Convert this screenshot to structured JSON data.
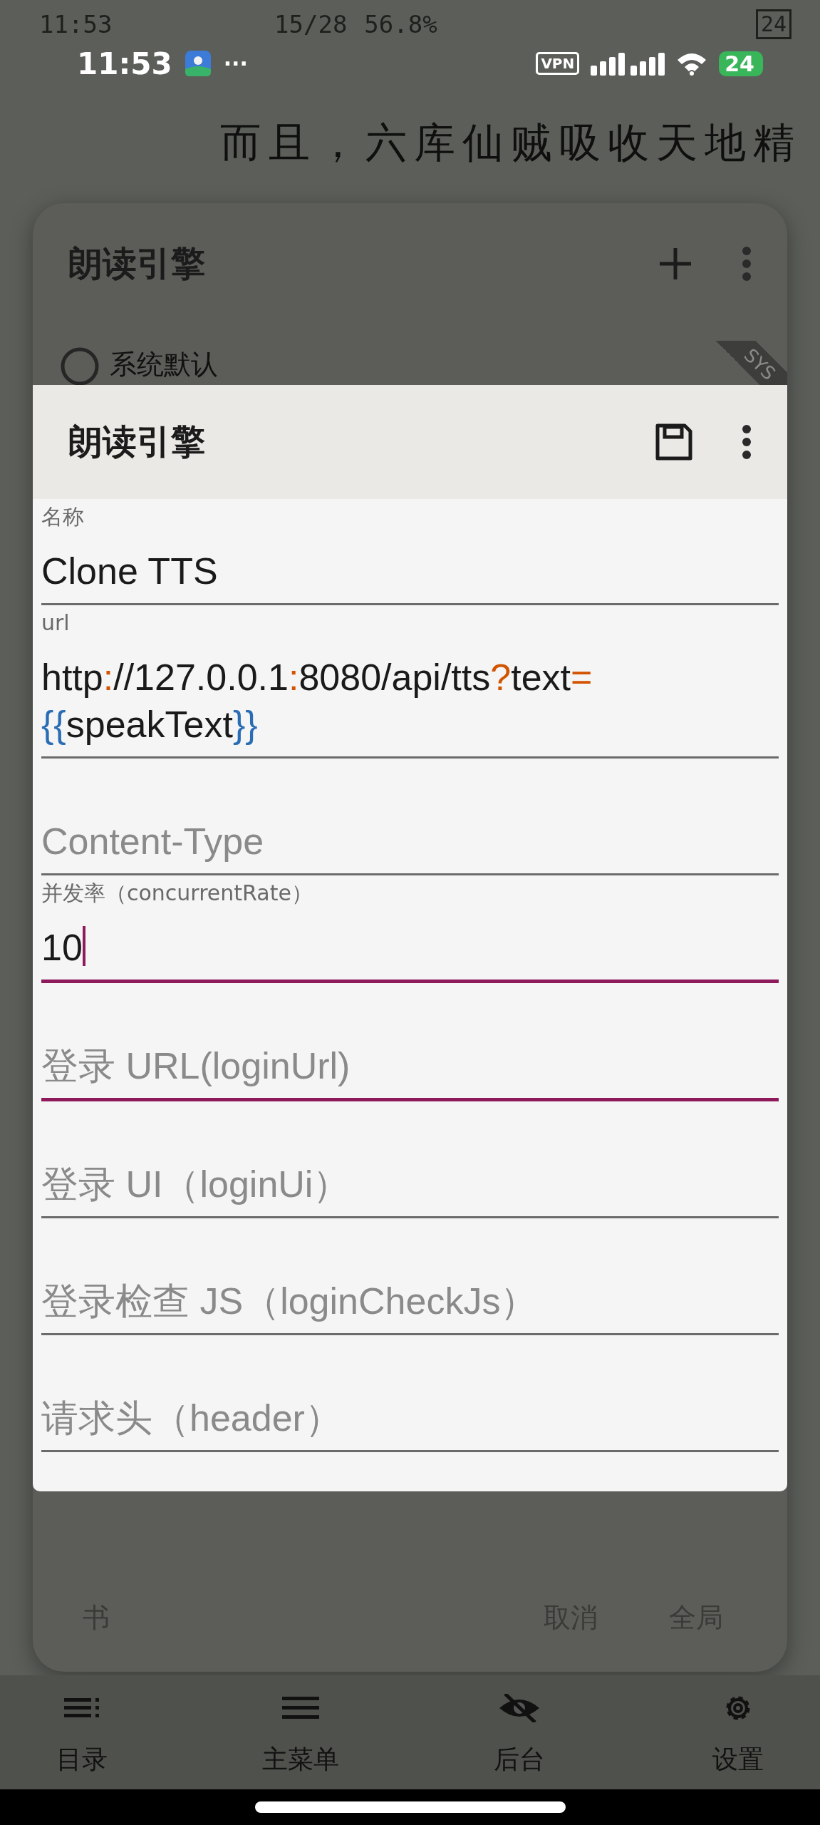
{
  "reader_status": {
    "time": "11:53",
    "progress": "15/28",
    "percent": "56.8%",
    "battery": "24"
  },
  "status_bar": {
    "time": "11:53",
    "more": "···",
    "vpn": "VPN",
    "battery": "24"
  },
  "reader_text": "而且，六库仙贼吸收天地精",
  "engine_list": {
    "title": "朗读引擎",
    "items": [
      {
        "label": "系统默认",
        "selected": false,
        "badge": "SYS"
      }
    ],
    "buttons": [
      "书",
      "取消",
      "全局"
    ]
  },
  "editor": {
    "title": "朗读引擎",
    "fields": [
      {
        "label": "名称",
        "value": "Clone TTS",
        "focused": false,
        "caret": false
      },
      {
        "label": "url",
        "segments": [
          {
            "text": "http",
            "kind": "text"
          },
          {
            "text": ":",
            "kind": "symbol"
          },
          {
            "text": "//127.0.0.1",
            "kind": "text"
          },
          {
            "text": ":",
            "kind": "symbol"
          },
          {
            "text": "8080/api/tts",
            "kind": "text"
          },
          {
            "text": "?",
            "kind": "symbol"
          },
          {
            "text": "text",
            "kind": "text"
          },
          {
            "text": "=",
            "kind": "symbol"
          },
          {
            "text": "{{",
            "kind": "brace"
          },
          {
            "text": "speakText",
            "kind": "text"
          },
          {
            "text": "}}",
            "kind": "brace"
          }
        ],
        "focused": false,
        "caret": false
      },
      {
        "placeholder": "Content-Type",
        "focused": false,
        "caret": false
      },
      {
        "label": "并发率（concurrentRate）",
        "value": "10",
        "focused": true,
        "caret": true
      },
      {
        "placeholder": "登录 URL(loginUrl)",
        "focused": true,
        "caret": false
      },
      {
        "placeholder": "登录 UI（loginUi）",
        "focused": false,
        "caret": false
      },
      {
        "placeholder": "登录检查 JS（loginCheckJs）",
        "focused": false,
        "caret": false
      },
      {
        "placeholder": "请求头（header）",
        "focused": false,
        "caret": false
      }
    ]
  },
  "bottom_nav": [
    {
      "label": "目录",
      "kind": "toc"
    },
    {
      "label": "主菜单",
      "kind": "menu"
    },
    {
      "label": "后台",
      "kind": "hidden"
    },
    {
      "label": "设置",
      "kind": "settings"
    }
  ]
}
